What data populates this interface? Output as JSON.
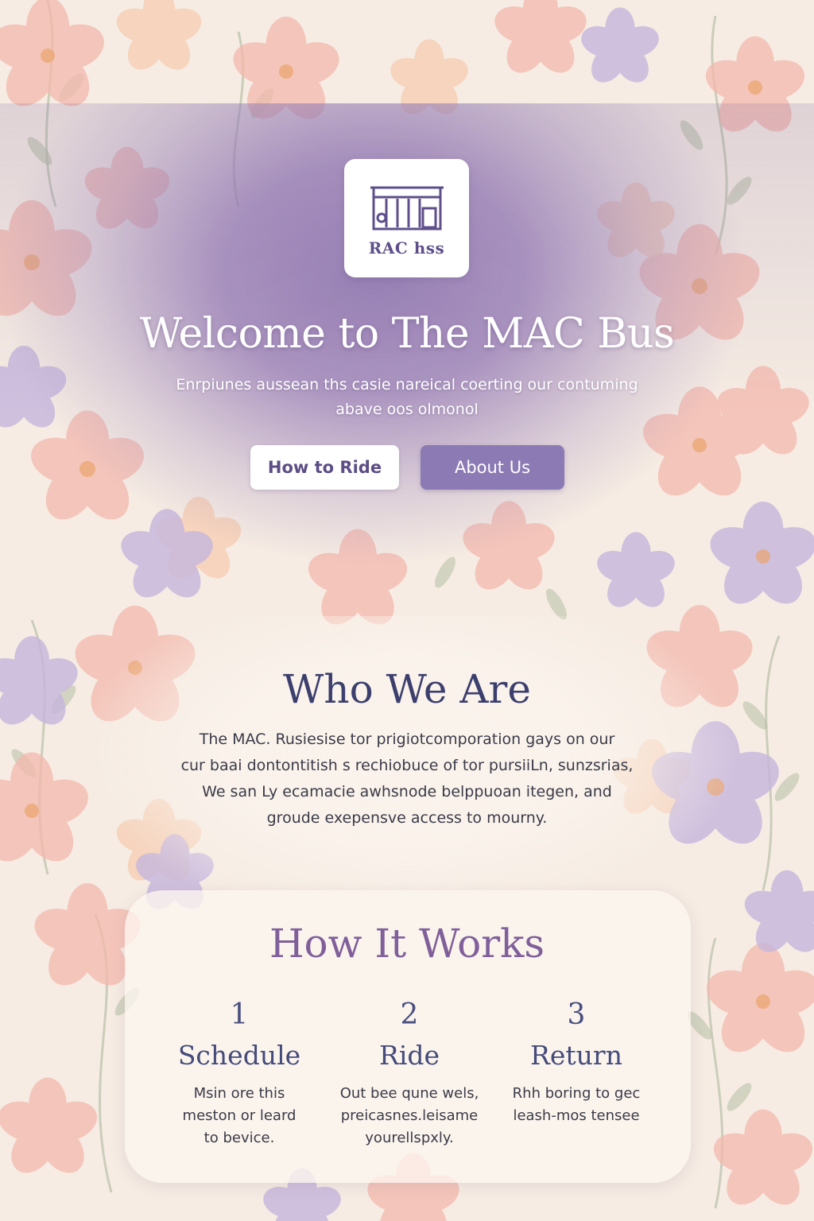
{
  "brand": {
    "logo_text": "RAC hss",
    "logo_icon": "building-icon"
  },
  "hero": {
    "title": "Welcome to The MAC Bus",
    "subtitle_line1": "Enrpiunes  aussean ths casie nareical coerting our contuming",
    "subtitle_line2": "abave oos olmonol",
    "primary_button": "How to Ride",
    "secondary_button": "About Us"
  },
  "who": {
    "title": "Who We Are",
    "lines": [
      "The MAC. Rusiesise tor prigiotcomporation gays on our",
      "cur baai dontontitish s rechiobuce of tor pursiiLn, sunzsrias,",
      "We san Ly ecamacie awhsnode belppuoan itegen, and",
      "groude exepensve access to mourny."
    ]
  },
  "how": {
    "title": "How It Works",
    "steps": [
      {
        "num": "1",
        "title": "Schedule",
        "desc": [
          "Msin ore this",
          "meston or leard",
          "to bevice."
        ]
      },
      {
        "num": "2",
        "title": "Ride",
        "desc": [
          "Out bee qune wels,",
          "preicasnes.leisame",
          "yourellspxly."
        ]
      },
      {
        "num": "3",
        "title": "Return",
        "desc": [
          "Rhh boring to gec",
          "leash-mos tensee"
        ]
      }
    ]
  },
  "colors": {
    "accent": "#8c7ab4",
    "hero_purple": "#967cb6",
    "heading_navy": "#3c3f6e",
    "how_title": "#80609a",
    "background": "#f6ece3"
  }
}
